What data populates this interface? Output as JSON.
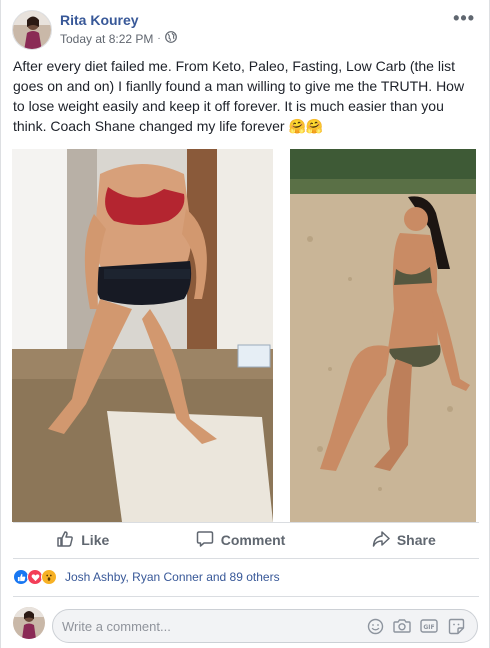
{
  "post": {
    "author": "Rita Kourey",
    "timestamp": "Today at 8:22 PM",
    "privacy_icon": "globe-icon",
    "text": "After every diet failed me. From Keto, Paleo, Fasting, Low Carb (the list goes on and on) I fianlly found a man willing to give me the TRUTH. How to lose weight easily and keep it off forever. It is much easier than you think. Coach Shane changed my life forever 🤗🤗",
    "more_icon": "•••",
    "brand_color": "#385898"
  },
  "photos": [
    {
      "name": "before-photo",
      "subject": "woman in red bra and underwear standing on rug indoors"
    },
    {
      "name": "after-photo",
      "subject": "woman in bikini sitting on sand at beach"
    }
  ],
  "actions": {
    "like_label": "Like",
    "comment_label": "Comment",
    "share_label": "Share"
  },
  "reactions": {
    "types": [
      "like",
      "love",
      "wow"
    ],
    "summary": "Josh Ashby, Ryan Conner and 89 others"
  },
  "comment_input": {
    "placeholder": "Write a comment..."
  }
}
